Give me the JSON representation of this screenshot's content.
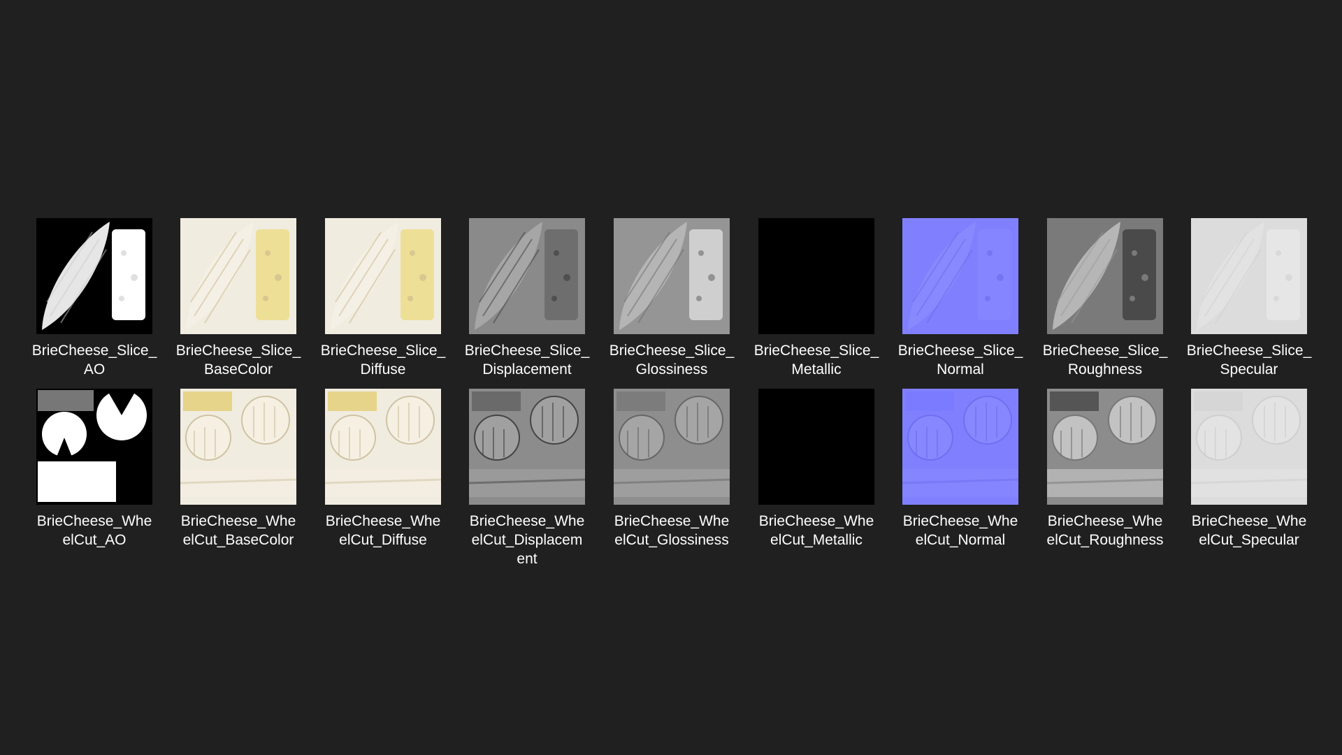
{
  "files": [
    {
      "name": "BrieCheese_Slice_\nAO",
      "kind": "ao",
      "set": "slice"
    },
    {
      "name": "BrieCheese_Slice_\nBaseColor",
      "kind": "basecolor",
      "set": "slice"
    },
    {
      "name": "BrieCheese_Slice_\nDiffuse",
      "kind": "diffuse",
      "set": "slice"
    },
    {
      "name": "BrieCheese_Slice_\nDisplacement",
      "kind": "displacement",
      "set": "slice"
    },
    {
      "name": "BrieCheese_Slice_\nGlossiness",
      "kind": "glossiness",
      "set": "slice"
    },
    {
      "name": "BrieCheese_Slice_\nMetallic",
      "kind": "metallic",
      "set": "slice"
    },
    {
      "name": "BrieCheese_Slice_\nNormal",
      "kind": "normal",
      "set": "slice"
    },
    {
      "name": "BrieCheese_Slice_\nRoughness",
      "kind": "roughness",
      "set": "slice"
    },
    {
      "name": "BrieCheese_Slice_\nSpecular",
      "kind": "specular",
      "set": "slice"
    },
    {
      "name": "BrieCheese_Whe\nelCut_AO",
      "kind": "ao",
      "set": "wheel"
    },
    {
      "name": "BrieCheese_Whe\nelCut_BaseColor",
      "kind": "basecolor",
      "set": "wheel"
    },
    {
      "name": "BrieCheese_Whe\nelCut_Diffuse",
      "kind": "diffuse",
      "set": "wheel"
    },
    {
      "name": "BrieCheese_Whe\nelCut_Displacem\nent",
      "kind": "displacement",
      "set": "wheel"
    },
    {
      "name": "BrieCheese_Whe\nelCut_Glossiness",
      "kind": "glossiness",
      "set": "wheel"
    },
    {
      "name": "BrieCheese_Whe\nelCut_Metallic",
      "kind": "metallic",
      "set": "wheel"
    },
    {
      "name": "BrieCheese_Whe\nelCut_Normal",
      "kind": "normal",
      "set": "wheel"
    },
    {
      "name": "BrieCheese_Whe\nelCut_Roughness",
      "kind": "roughness",
      "set": "wheel"
    },
    {
      "name": "BrieCheese_Whe\nelCut_Specular",
      "kind": "specular",
      "set": "wheel"
    }
  ],
  "colors": {
    "background": "#202020",
    "text": "#ffffff",
    "ao_bg": "#000000",
    "ao_fg": "#f4f4f4",
    "basecolor_bg": "#f1ece0",
    "basecolor_accent": "#eedf96",
    "displacement_bg": "#8a8a8a",
    "glossiness_bg": "#959595",
    "metallic_bg": "#000000",
    "normal_bg": "#8080ff",
    "roughness_bg": "#7a7a7a",
    "specular_bg": "#dcdcdc"
  }
}
